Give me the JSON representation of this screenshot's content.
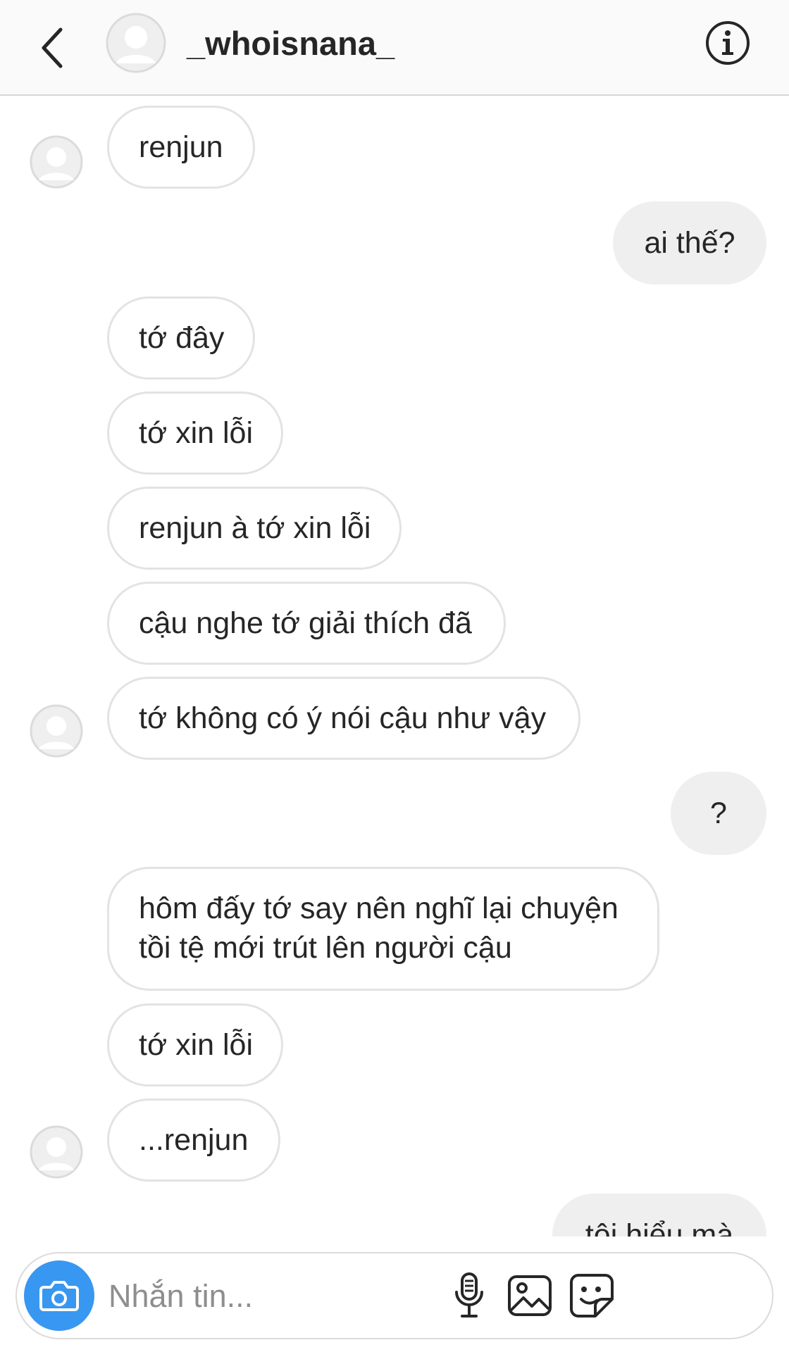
{
  "header": {
    "username": "_whoisnana_",
    "icons": {
      "back": "chevron-left-icon",
      "info": "info-icon"
    }
  },
  "messages": [
    {
      "side": "in",
      "text": "renjun"
    },
    {
      "side": "out",
      "text": "ai thế?"
    },
    {
      "side": "in",
      "text": "tớ đây"
    },
    {
      "side": "in",
      "text": "tớ xin lỗi"
    },
    {
      "side": "in",
      "text": "renjun à tớ xin lỗi"
    },
    {
      "side": "in",
      "text": "cậu nghe tớ giải thích đã"
    },
    {
      "side": "in",
      "text": "tớ không có ý nói cậu như vậy"
    },
    {
      "side": "out",
      "text": "?"
    },
    {
      "side": "in",
      "text": "hôm đấy tớ say nên nghĩ lại chuyện tồi tệ mới trút lên người cậu"
    },
    {
      "side": "in",
      "text": "tớ xin lỗi"
    },
    {
      "side": "in",
      "text": "...renjun"
    },
    {
      "side": "out",
      "text": "tôi hiểu mà"
    }
  ],
  "composer": {
    "placeholder": "Nhắn tin...",
    "value": "",
    "icons": [
      "camera-icon",
      "microphone-icon",
      "gallery-icon",
      "sticker-icon"
    ]
  },
  "colors": {
    "accent": "#3897f0",
    "incoming_bubble_border": "#e3e3e3",
    "outgoing_bubble": "#efefef",
    "text": "#262626",
    "placeholder": "#8e8e8e"
  }
}
